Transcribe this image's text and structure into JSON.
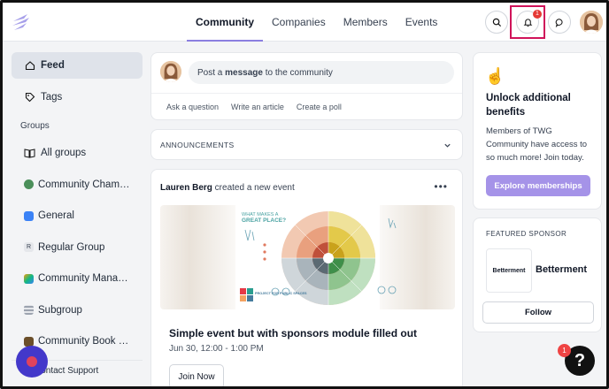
{
  "header": {
    "nav": [
      {
        "label": "Community",
        "active": true
      },
      {
        "label": "Companies",
        "active": false
      },
      {
        "label": "Members",
        "active": false
      },
      {
        "label": "Events",
        "active": false
      }
    ],
    "notification_count": "1",
    "icons": [
      "search-icon",
      "bell-icon",
      "chat-icon"
    ],
    "accent_color": "#8b7fe0"
  },
  "sidebar": {
    "feed": "Feed",
    "tags": "Tags",
    "groups_heading": "Groups",
    "all_groups": "All groups",
    "groups": [
      {
        "label": "Community Champions",
        "color": "#4b8f5a"
      },
      {
        "label": "General",
        "color": "#3b82f6"
      },
      {
        "label": "Regular Group",
        "icon_letter": "R",
        "color": "#e5e7eb"
      },
      {
        "label": "Community Managers",
        "color": "#f59e0b"
      },
      {
        "label": "Subgroup",
        "color": "#9ca3af"
      },
      {
        "label": "Community Book Club",
        "color": "#6b4f2a"
      }
    ],
    "contact_support": "Contact Support"
  },
  "composer": {
    "prompt_prefix": "Post a ",
    "prompt_bold": "message",
    "prompt_suffix": " to the community",
    "actions": [
      "Ask a question",
      "Write an article",
      "Create a poll"
    ]
  },
  "announcements": {
    "label": "ANNOUNCEMENTS"
  },
  "post": {
    "author": "Lauren Berg",
    "action_text": " created a new event",
    "image_heading_line1": "WHAT MAKES A",
    "image_heading_line2": "GREAT PLACE?",
    "image_logo": "PROJECT FOR PUBLIC SPACES",
    "event_title": "Simple event but with sponsors module filled out",
    "event_date": "Jun 30, 12:00 - 1:00 PM",
    "join_label": "Join Now"
  },
  "unlock": {
    "emoji": "☝️",
    "title": "Unlock additional benefits",
    "description": "Members of TWG Community have access to so much more! Join today.",
    "button": "Explore memberships",
    "button_color": "#a593e8"
  },
  "sponsor": {
    "label": "FEATURED SPONSOR",
    "logo_text": "Betterment",
    "name": "Betterment",
    "follow": "Follow"
  },
  "help": {
    "label": "?",
    "badge": "1"
  }
}
